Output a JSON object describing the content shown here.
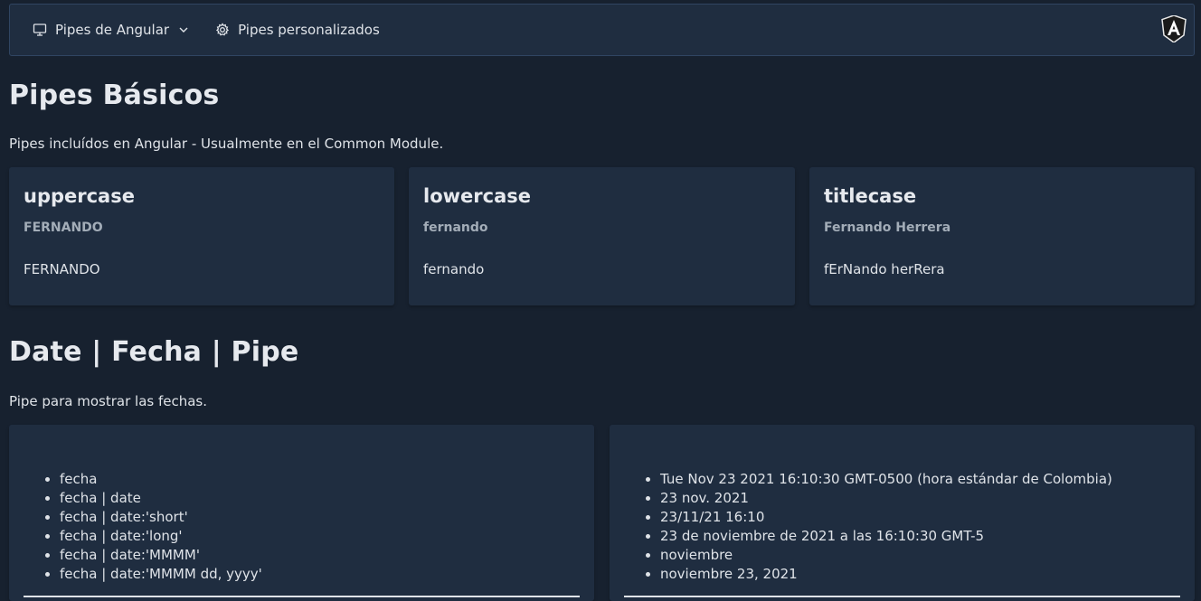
{
  "menubar": {
    "items": [
      {
        "label": "Pipes de Angular",
        "icon": "desktop-icon",
        "has_dropdown": true
      },
      {
        "label": "Pipes personalizados",
        "icon": "gear-icon",
        "has_dropdown": false
      }
    ],
    "logo": "angular-logo"
  },
  "basic_section": {
    "title": "Pipes Básicos",
    "subtitle": "Pipes incluídos en Angular - Usualmente en el Common Module.",
    "cards": [
      {
        "title": "uppercase",
        "subtitle": "FERNANDO",
        "content": "FERNANDO"
      },
      {
        "title": "lowercase",
        "subtitle": "fernando",
        "content": "fernando"
      },
      {
        "title": "titlecase",
        "subtitle": "Fernando Herrera",
        "content": "fErNando herRera"
      }
    ]
  },
  "date_section": {
    "title": "Date | Fecha | Pipe",
    "subtitle": "Pipe para mostrar las fechas.",
    "left_list": [
      "fecha",
      "fecha | date",
      "fecha | date:'short'",
      "fecha | date:'long'",
      "fecha | date:'MMMM'",
      "fecha | date:'MMMM dd, yyyy'"
    ],
    "right_list": [
      "Tue Nov 23 2021 16:10:30 GMT-0500 (hora estándar de Colombia)",
      "23 nov. 2021",
      "23/11/21 16:10",
      "23 de noviembre de 2021 a las 16:10:30 GMT-5",
      "noviembre",
      "noviembre 23, 2021"
    ]
  },
  "colors": {
    "background": "#17212f",
    "panel": "#1f2d40",
    "text": "#dfe3e8",
    "muted": "#a3adb8"
  }
}
